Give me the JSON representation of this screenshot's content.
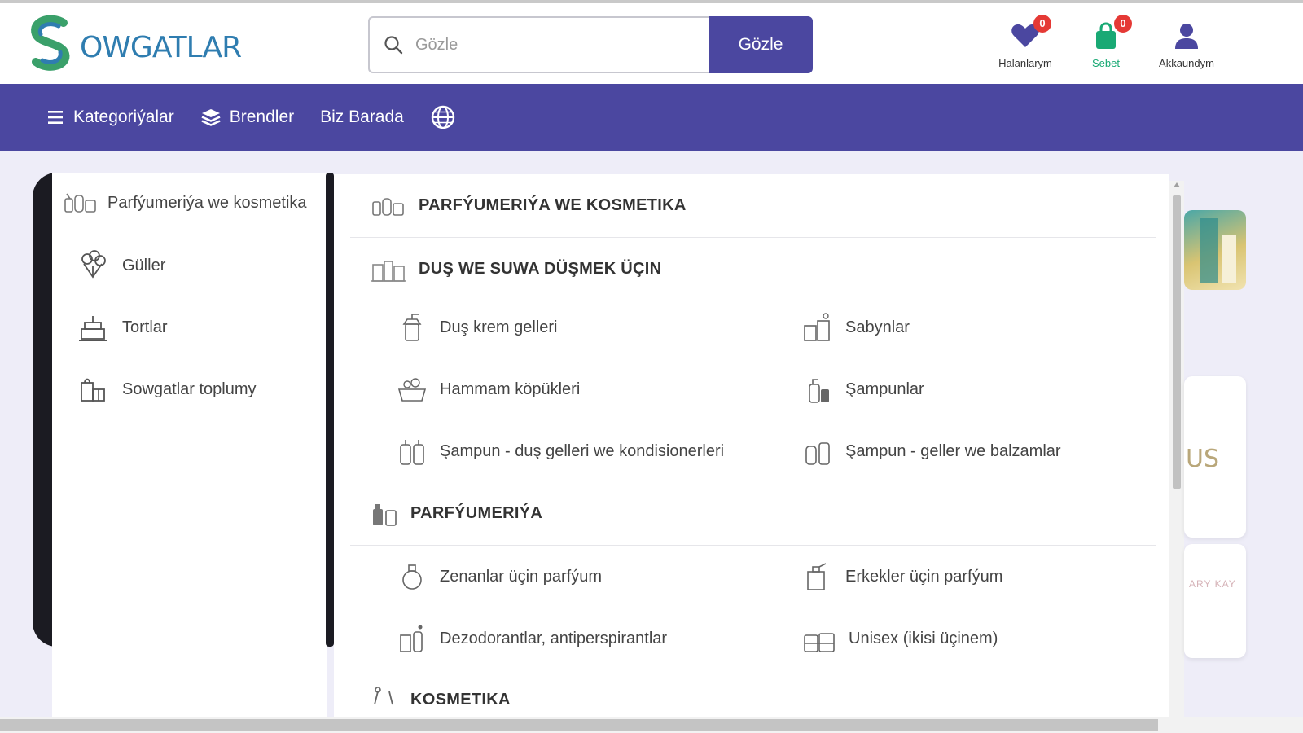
{
  "header": {
    "logo_text": "OWGATLAR",
    "search": {
      "placeholder": "Gözle",
      "button_label": "Gözle"
    },
    "wishlist": {
      "label": "Halanlarym",
      "count": "0"
    },
    "cart": {
      "label": "Sebet",
      "count": "0"
    },
    "account": {
      "label": "Akkaundym"
    }
  },
  "nav": {
    "categories": "Kategoriýalar",
    "brands": "Brendler",
    "about": "Biz Barada"
  },
  "menu": {
    "left": [
      {
        "label": "Parfýumeriýa we kosmetika",
        "icon": "cosmetics-icon"
      },
      {
        "label": "Güller",
        "icon": "flowers-icon"
      },
      {
        "label": "Tortlar",
        "icon": "cake-icon"
      },
      {
        "label": "Sowgatlar toplumy",
        "icon": "gift-set-icon"
      }
    ],
    "sections": [
      {
        "title": "PARFÝUMERIÝA WE KOSMETIKA"
      },
      {
        "title": "DUŞ WE SUWA DÜŞMEK ÜÇIN"
      },
      {
        "title": "PARFÝUMERIÝA"
      },
      {
        "title": "KOSMETIKA"
      }
    ],
    "shower_items": [
      "Duş krem gelleri",
      "Sabynlar",
      "Hammam köpükleri",
      "Şampunlar",
      "Şampun - duş gelleri we kondisionerleri",
      "Şampun - geller we balzamlar"
    ],
    "perfume_items": [
      "Zenanlar üçin parfýum",
      "Erkekler üçin parfýum",
      "Dezodorantlar, antiperspirantlar",
      "Unisex (ikisi üçinem)"
    ]
  },
  "side": {
    "card_text": "US",
    "card_small_text": "ARY KAY"
  },
  "colors": {
    "brand_purple": "#4b47a0",
    "badge_red": "#e53935",
    "cart_green": "#19a974",
    "logo_teal": "#2f7db0"
  }
}
